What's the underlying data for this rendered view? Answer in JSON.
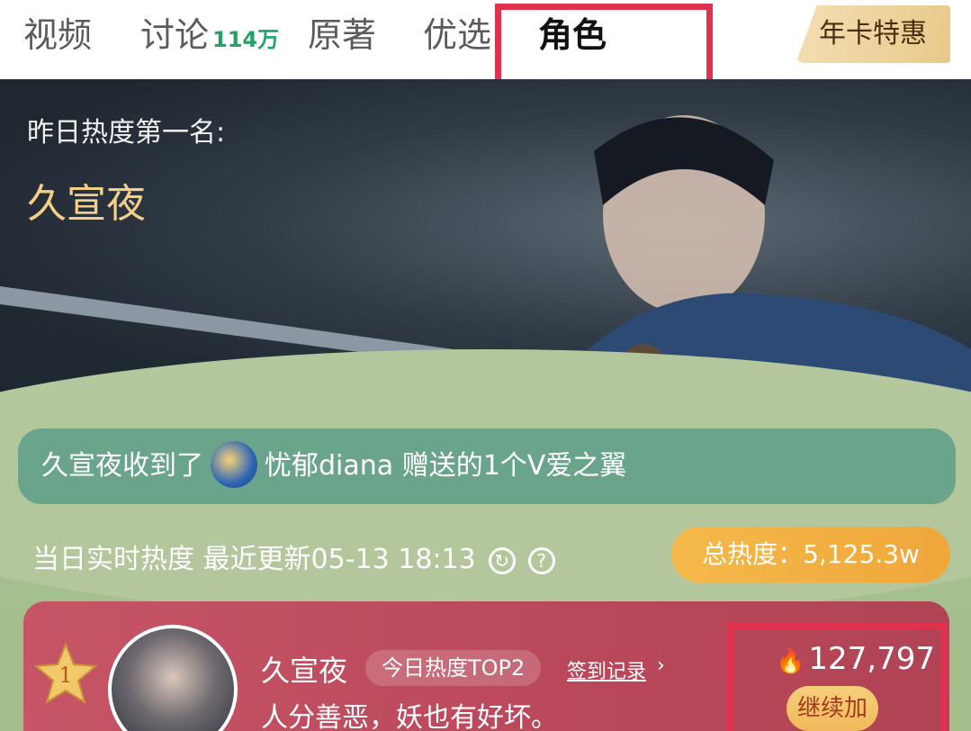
{
  "tabs": [
    {
      "label": "视频",
      "active": false
    },
    {
      "label": "讨论",
      "count": "114万",
      "active": false
    },
    {
      "label": "原著",
      "active": false
    },
    {
      "label": "优选",
      "active": false
    },
    {
      "label": "角色",
      "active": true
    }
  ],
  "vip": {
    "label": "年卡特惠"
  },
  "hero": {
    "label": "昨日热度第一名:",
    "name": "久宣夜"
  },
  "notice": {
    "prefix": "久宣夜收到了",
    "text": "忧郁diana 赠送的1个V爱之翼"
  },
  "stats": {
    "text": "当日实时热度 最近更新05-13 18:13",
    "refresh_icon": "refresh-icon",
    "help_icon": "help-icon",
    "help_glyph": "?"
  },
  "total": {
    "label": "总热度：5,125.3w"
  },
  "ranking": {
    "rank": "1",
    "name": "久宣夜",
    "tag": "今日热度TOP2",
    "signin_label": "签到记录",
    "signin_arrow": "›",
    "motto": "人分善恶，妖也有好坏。",
    "heat_value": "127,797",
    "add_button": "继续加"
  },
  "colors": {
    "accent_green": "#21a366",
    "highlight_red": "#e0314e",
    "card_red": "#c65566"
  }
}
